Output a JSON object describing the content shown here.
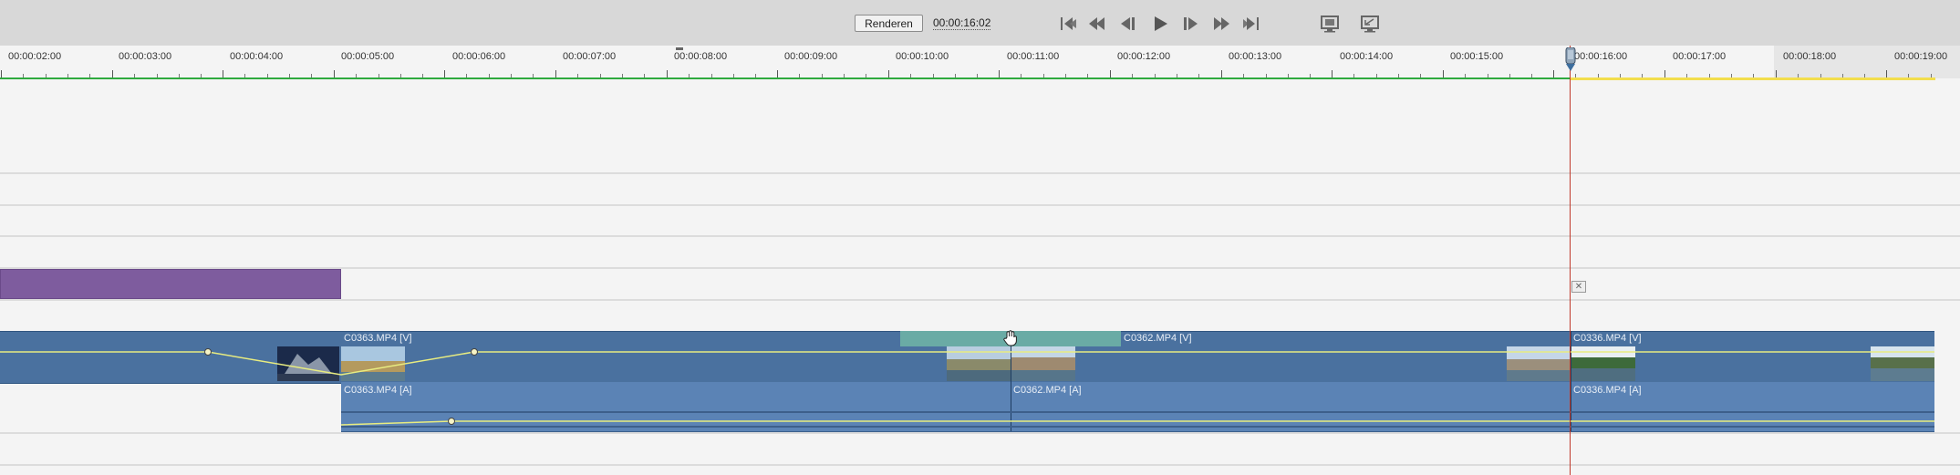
{
  "toolbar": {
    "render_label": "Renderen",
    "timecode": "00:00:16:02",
    "controls": [
      "go-to-start-icon",
      "step-back-icon",
      "frame-back-icon",
      "play-icon",
      "frame-forward-icon",
      "step-forward-icon",
      "go-to-end-icon",
      "safe-margins-icon",
      "fullscreen-icon"
    ]
  },
  "ruler": {
    "labels": [
      "00:00:02:00",
      "00:00:03:00",
      "00:00:04:00",
      "00:00:05:00",
      "00:00:06:00",
      "00:00:07:00",
      "00:00:08:00",
      "00:00:09:00",
      "00:00:10:00",
      "00:00:11:00",
      "00:00:12:00",
      "00:00:13:00",
      "00:00:14:00",
      "00:00:15:00",
      "00:00:16:00",
      "00:00:17:00",
      "00:00:18:00",
      "00:00:19:00"
    ]
  },
  "clips": {
    "v1_a": "C0363.MP4 [V]",
    "v1_b": "C0362.MP4 [V]",
    "v1_c": "C0336.MP4 [V]",
    "a1_a": "C0363.MP4 [A]",
    "a1_b": "C0362.MP4 [A]",
    "a1_c": "C0336.MP4 [A]"
  },
  "colors": {
    "title_clip": "#7e5c9e",
    "video_clip": "#4a719f",
    "audio_clip": "#5b83b5",
    "transition": "#6aaba5",
    "playhead": "#c0392b",
    "ruler_green": "#2faa3e",
    "ruler_yellow": "#f2de4d"
  }
}
